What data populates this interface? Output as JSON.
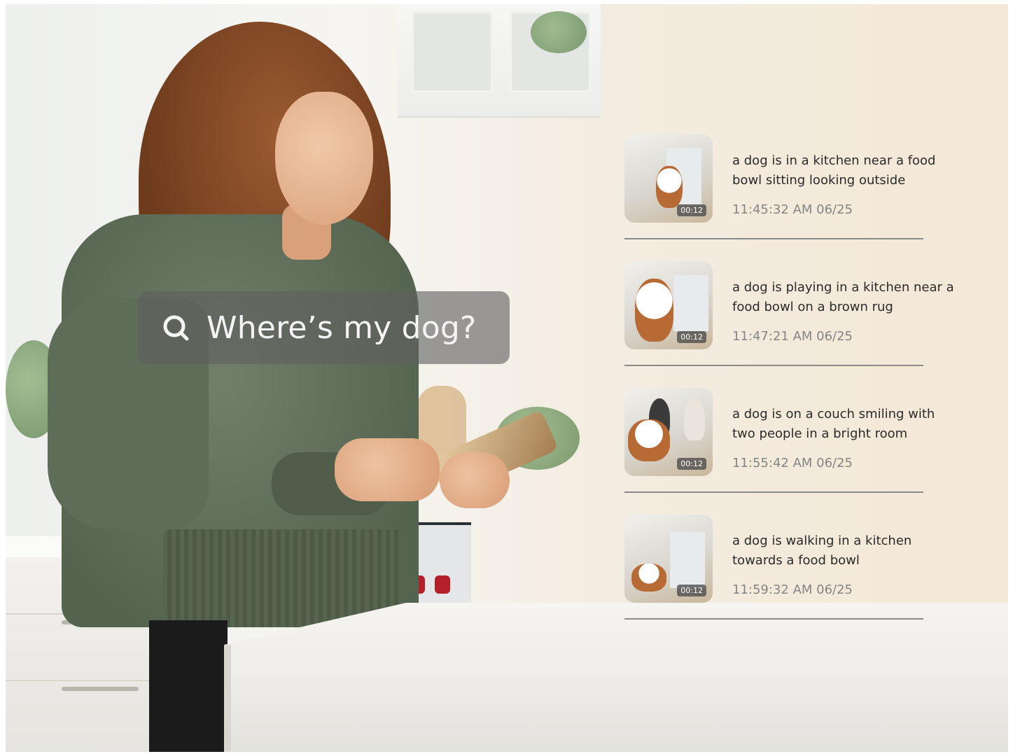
{
  "search": {
    "query": "Where’s my dog?",
    "icon": "search-icon"
  },
  "results": [
    {
      "description": "a dog is in a kitchen near a food bowl sitting looking outside",
      "duration": "00:12",
      "timestamp": "11:45:32 AM 06/25"
    },
    {
      "description": "a dog is playing in a kitchen near a food bowl on a brown rug",
      "duration": "00:12",
      "timestamp": "11:47:21 AM 06/25"
    },
    {
      "description": "a dog is on a couch smiling with two people in a bright room",
      "duration": "00:12",
      "timestamp": "11:55:42 AM 06/25"
    },
    {
      "description": "a dog is walking in a kitchen towards a food bowl",
      "duration": "00:12",
      "timestamp": "11:59:32 AM 06/25"
    }
  ],
  "colors": {
    "search_pill": "#606060",
    "text_primary": "#2a2a2a",
    "text_secondary": "#858585",
    "divider": "#8a8a88"
  }
}
